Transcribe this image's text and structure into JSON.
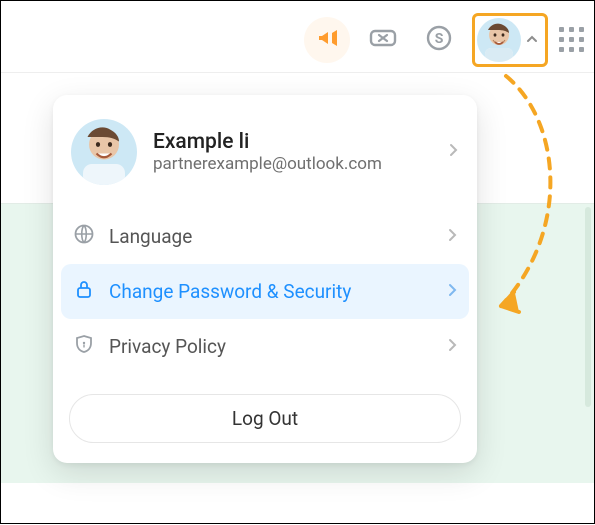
{
  "toolbar": {
    "icons": [
      "announcement-icon",
      "coupon-icon",
      "coin-icon"
    ],
    "menu_collapsed": false
  },
  "profile": {
    "name": "Example li",
    "email": "partnerexample@outlook.com"
  },
  "menu": {
    "language": "Language",
    "security": "Change Password & Security",
    "privacy": "Privacy Policy",
    "logout": "Log Out"
  },
  "colors": {
    "highlight_bg": "#eaf5ff",
    "highlight_text": "#1e90ff",
    "accent": "#f5a623"
  }
}
